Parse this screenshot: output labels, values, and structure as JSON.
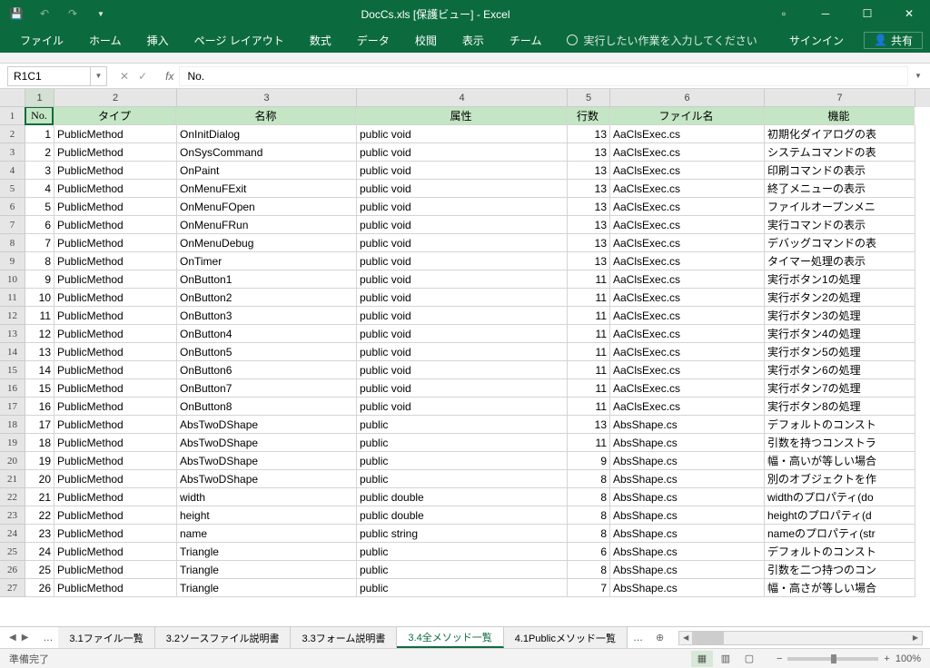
{
  "title": "DocCs.xls [保護ビュー] - Excel",
  "ribbon": {
    "tabs": [
      "ファイル",
      "ホーム",
      "挿入",
      "ページ レイアウト",
      "数式",
      "データ",
      "校閲",
      "表示",
      "チーム"
    ],
    "tellme": "実行したい作業を入力してください",
    "signin": "サインイン",
    "share": "共有"
  },
  "namebox": "R1C1",
  "formula": "No.",
  "cols": [
    "1",
    "2",
    "3",
    "4",
    "5",
    "6",
    "7"
  ],
  "headers": {
    "c1": "No.",
    "c2": "タイプ",
    "c3": "名称",
    "c4": "属性",
    "c5": "行数",
    "c6": "ファイル名",
    "c7": "機能"
  },
  "rows": [
    {
      "n": "1",
      "t": "PublicMethod",
      "name": "OnInitDialog",
      "attr": "public void",
      "l": "13",
      "f": "AaClsExec.cs",
      "d": "初期化ダイアログの表"
    },
    {
      "n": "2",
      "t": "PublicMethod",
      "name": "OnSysCommand",
      "attr": "public void",
      "l": "13",
      "f": "AaClsExec.cs",
      "d": "システムコマンドの表"
    },
    {
      "n": "3",
      "t": "PublicMethod",
      "name": "OnPaint",
      "attr": "public void",
      "l": "13",
      "f": "AaClsExec.cs",
      "d": "印刷コマンドの表示"
    },
    {
      "n": "4",
      "t": "PublicMethod",
      "name": "OnMenuFExit",
      "attr": "public void",
      "l": "13",
      "f": "AaClsExec.cs",
      "d": "終了メニューの表示"
    },
    {
      "n": "5",
      "t": "PublicMethod",
      "name": "OnMenuFOpen",
      "attr": "public void",
      "l": "13",
      "f": "AaClsExec.cs",
      "d": "ファイルオープンメニ"
    },
    {
      "n": "6",
      "t": "PublicMethod",
      "name": "OnMenuFRun",
      "attr": "public void",
      "l": "13",
      "f": "AaClsExec.cs",
      "d": "実行コマンドの表示"
    },
    {
      "n": "7",
      "t": "PublicMethod",
      "name": "OnMenuDebug",
      "attr": "public void",
      "l": "13",
      "f": "AaClsExec.cs",
      "d": "デバッグコマンドの表"
    },
    {
      "n": "8",
      "t": "PublicMethod",
      "name": "OnTimer",
      "attr": "public void",
      "l": "13",
      "f": "AaClsExec.cs",
      "d": "タイマー処理の表示"
    },
    {
      "n": "9",
      "t": "PublicMethod",
      "name": "OnButton1",
      "attr": "public void",
      "l": "11",
      "f": "AaClsExec.cs",
      "d": "実行ボタン1の処理"
    },
    {
      "n": "10",
      "t": "PublicMethod",
      "name": "OnButton2",
      "attr": "public void",
      "l": "11",
      "f": "AaClsExec.cs",
      "d": "実行ボタン2の処理"
    },
    {
      "n": "11",
      "t": "PublicMethod",
      "name": "OnButton3",
      "attr": "public void",
      "l": "11",
      "f": "AaClsExec.cs",
      "d": "実行ボタン3の処理"
    },
    {
      "n": "12",
      "t": "PublicMethod",
      "name": "OnButton4",
      "attr": "public void",
      "l": "11",
      "f": "AaClsExec.cs",
      "d": "実行ボタン4の処理"
    },
    {
      "n": "13",
      "t": "PublicMethod",
      "name": "OnButton5",
      "attr": "public void",
      "l": "11",
      "f": "AaClsExec.cs",
      "d": "実行ボタン5の処理"
    },
    {
      "n": "14",
      "t": "PublicMethod",
      "name": "OnButton6",
      "attr": "public void",
      "l": "11",
      "f": "AaClsExec.cs",
      "d": "実行ボタン6の処理"
    },
    {
      "n": "15",
      "t": "PublicMethod",
      "name": "OnButton7",
      "attr": "public void",
      "l": "11",
      "f": "AaClsExec.cs",
      "d": "実行ボタン7の処理"
    },
    {
      "n": "16",
      "t": "PublicMethod",
      "name": "OnButton8",
      "attr": "public void",
      "l": "11",
      "f": "AaClsExec.cs",
      "d": "実行ボタン8の処理"
    },
    {
      "n": "17",
      "t": "PublicMethod",
      "name": "AbsTwoDShape",
      "attr": "public",
      "l": "13",
      "f": "AbsShape.cs",
      "d": "デフォルトのコンスト"
    },
    {
      "n": "18",
      "t": "PublicMethod",
      "name": "AbsTwoDShape",
      "attr": "public",
      "l": "11",
      "f": "AbsShape.cs",
      "d": "引数を持つコンストラ"
    },
    {
      "n": "19",
      "t": "PublicMethod",
      "name": "AbsTwoDShape",
      "attr": "public",
      "l": "9",
      "f": "AbsShape.cs",
      "d": "幅・高いが等しい場合"
    },
    {
      "n": "20",
      "t": "PublicMethod",
      "name": "AbsTwoDShape",
      "attr": "public",
      "l": "8",
      "f": "AbsShape.cs",
      "d": "別のオブジェクトを作"
    },
    {
      "n": "21",
      "t": "PublicMethod",
      "name": "width",
      "attr": "public double",
      "l": "8",
      "f": "AbsShape.cs",
      "d": "widthのプロパティ(do"
    },
    {
      "n": "22",
      "t": "PublicMethod",
      "name": "height",
      "attr": "public double",
      "l": "8",
      "f": "AbsShape.cs",
      "d": "heightのプロパティ(d"
    },
    {
      "n": "23",
      "t": "PublicMethod",
      "name": "name",
      "attr": "public string",
      "l": "8",
      "f": "AbsShape.cs",
      "d": "nameのプロパティ(str"
    },
    {
      "n": "24",
      "t": "PublicMethod",
      "name": "Triangle",
      "attr": "public",
      "l": "6",
      "f": "AbsShape.cs",
      "d": "デフォルトのコンスト"
    },
    {
      "n": "25",
      "t": "PublicMethod",
      "name": "Triangle",
      "attr": "public",
      "l": "8",
      "f": "AbsShape.cs",
      "d": "引数を二つ持つのコン"
    },
    {
      "n": "26",
      "t": "PublicMethod",
      "name": "Triangle",
      "attr": "public",
      "l": "7",
      "f": "AbsShape.cs",
      "d": "幅・高さが等しい場合"
    }
  ],
  "sheets": [
    "3.1ファイル一覧",
    "3.2ソースファイル説明書",
    "3.3フォーム説明書",
    "3.4全メソッド一覧",
    "4.1Publicメソッド一覧"
  ],
  "status": "準備完了",
  "zoom": "100%"
}
